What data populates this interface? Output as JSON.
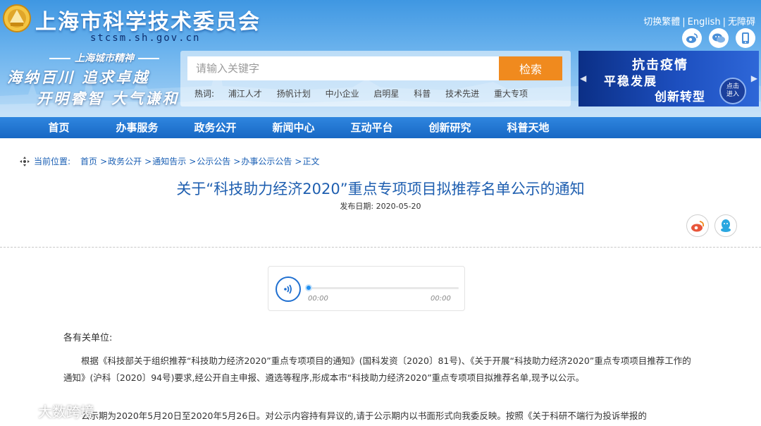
{
  "header": {
    "site_title": "上海市科学技术委员会",
    "site_domain": "stcsm.sh.gov.cn",
    "spirit_title": "上海城市精神",
    "spirit_line1": "海纳百川  追求卓越",
    "spirit_line2": "开明睿智  大气谦和",
    "top_links": [
      "切换繁體",
      "English",
      "无障碍"
    ],
    "social_icons": [
      "weibo-icon",
      "wechat-icon",
      "mobile-icon"
    ]
  },
  "search": {
    "placeholder": "请输入关键字",
    "button_label": "检索",
    "hot_label": "热词:",
    "hot_words": [
      "浦江人才",
      "扬帆计划",
      "中小企业",
      "启明星",
      "科普",
      "技术先进",
      "重大专项"
    ]
  },
  "banner": {
    "line1": "抗击疫情",
    "line2": "平稳发展",
    "line3": "创新转型",
    "click_line1": "点击",
    "click_line2": "进入"
  },
  "nav": {
    "items": [
      "首页",
      "办事服务",
      "政务公开",
      "新闻中心",
      "互动平台",
      "创新研究",
      "科普天地"
    ]
  },
  "breadcrumb": {
    "label": "当前位置:",
    "items": [
      "首页",
      "政务公开",
      "通知告示",
      "公示公告",
      "办事公示公告",
      "正文"
    ]
  },
  "article": {
    "title": "关于“科技助力经济2020”重点专项项目拟推荐名单公示的通知",
    "date": "发布日期: 2020-05-20",
    "audio_current": "00:00",
    "audio_total": "00:00",
    "salutation": "各有关单位:",
    "paragraph1": "根据《科技部关于组织推荐“科技助力经济2020”重点专项项目的通知》(国科发资〔2020〕81号)、《关于开展“科技助力经济2020”重点专项项目推荐工作的通知》(沪科〔2020〕94号)要求,经公开自主申报、遴选等程序,形成本市“科技助力经济2020”重点专项项目拟推荐名单,现予以公示。",
    "paragraph2": "公示期为2020年5月20日至2020年5月26日。对公示内容持有异议的,请于公示期内以书面形式向我委反映。按照《关于科研不端行为投诉举报的"
  },
  "watermark": {
    "text": "大数跨境"
  }
}
